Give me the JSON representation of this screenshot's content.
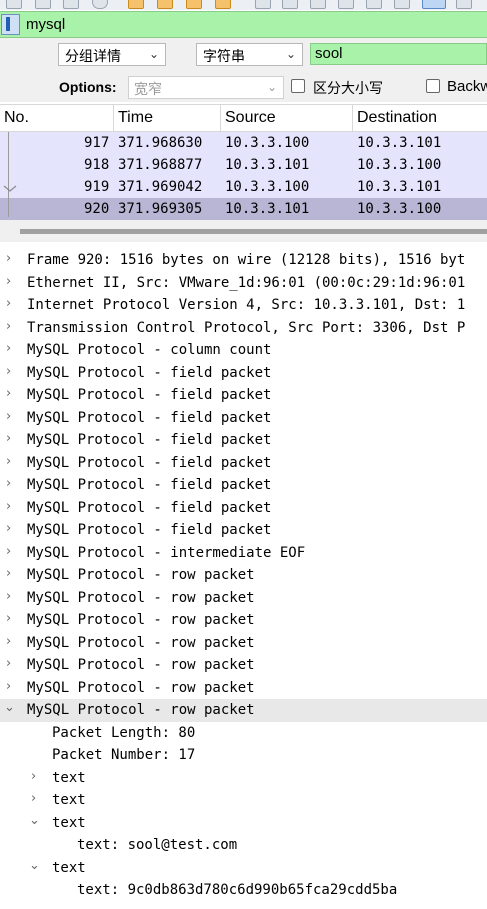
{
  "filter": {
    "text": "mysql"
  },
  "find": {
    "scope_value": "分组详情",
    "type_value": "字符串",
    "search_value": "sool",
    "options_label": "Options:",
    "options_value": "宽窄",
    "case_label": "区分大小写",
    "backward_label": "Backw"
  },
  "columns": {
    "no": "No.",
    "time": "Time",
    "source": "Source",
    "destination": "Destination"
  },
  "packets": [
    {
      "no": "917",
      "time": "371.968630",
      "source": "10.3.3.100",
      "destination": "10.3.3.101"
    },
    {
      "no": "918",
      "time": "371.968877",
      "source": "10.3.3.101",
      "destination": "10.3.3.100"
    },
    {
      "no": "919",
      "time": "371.969042",
      "source": "10.3.3.100",
      "destination": "10.3.3.101"
    },
    {
      "no": "920",
      "time": "371.969305",
      "source": "10.3.3.101",
      "destination": "10.3.3.100"
    }
  ],
  "details": [
    "Frame 920: 1516 bytes on wire (12128 bits), 1516 byt",
    "Ethernet II, Src: VMware_1d:96:01 (00:0c:29:1d:96:01",
    "Internet Protocol Version 4, Src: 10.3.3.101, Dst: 1",
    "Transmission Control Protocol, Src Port: 3306, Dst P",
    "MySQL Protocol - column count",
    "MySQL Protocol - field packet",
    "MySQL Protocol - field packet",
    "MySQL Protocol - field packet",
    "MySQL Protocol - field packet",
    "MySQL Protocol - field packet",
    "MySQL Protocol - field packet",
    "MySQL Protocol - field packet",
    "MySQL Protocol - field packet",
    "MySQL Protocol - intermediate EOF",
    "MySQL Protocol - row packet",
    "MySQL Protocol - row packet",
    "MySQL Protocol - row packet",
    "MySQL Protocol - row packet",
    "MySQL Protocol - row packet",
    "MySQL Protocol - row packet",
    "MySQL Protocol - row packet"
  ],
  "expanded": {
    "packet_length": "Packet Length: 80",
    "packet_number": "Packet Number: 17",
    "text1": "text",
    "text2": "text",
    "text3": "text",
    "text3_value": "text: sool@test.com",
    "text4": "text",
    "text4_value": "text: 9c0db863d780c6d990b65fca29cdd5ba"
  },
  "icons": {
    "collapsed": "chevron-right-icon",
    "expanded": "chevron-down-icon",
    "bookmark": "bookmark-icon"
  }
}
